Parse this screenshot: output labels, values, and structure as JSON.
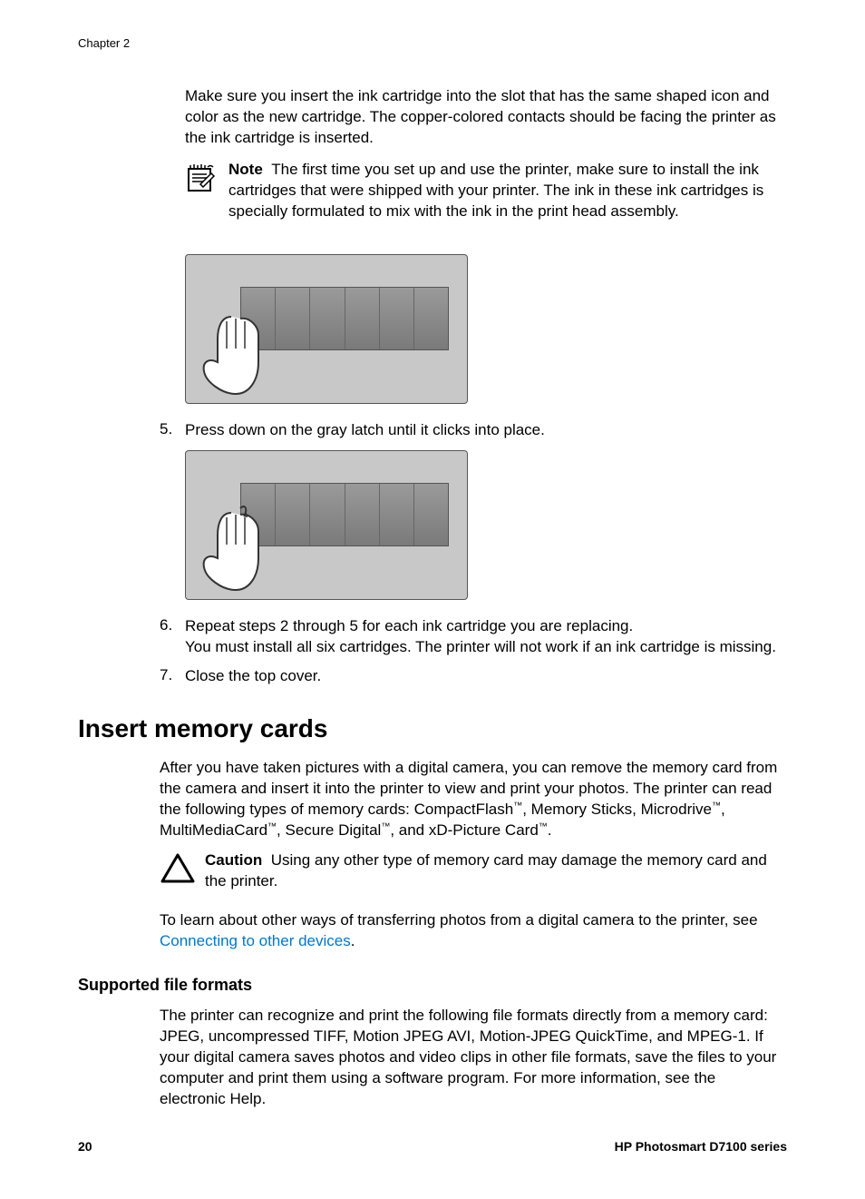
{
  "header": {
    "chapter": "Chapter 2"
  },
  "intro_para": "Make sure you insert the ink cartridge into the slot that has the same shaped icon and color as the new cartridge. The copper-colored contacts should be facing the printer as the ink cartridge is inserted.",
  "note": {
    "label": "Note",
    "text": "The first time you set up and use the printer, make sure to install the ink cartridges that were shipped with your printer. The ink in these ink cartridges is specially formulated to mix with the ink in the print head assembly."
  },
  "steps": {
    "s5": {
      "num": "5.",
      "text": "Press down on the gray latch until it clicks into place."
    },
    "s6": {
      "num": "6.",
      "text_a": "Repeat steps 2 through 5 for each ink cartridge you are replacing.",
      "text_b": "You must install all six cartridges. The printer will not work if an ink cartridge is missing."
    },
    "s7": {
      "num": "7.",
      "text": "Close the top cover."
    }
  },
  "section": {
    "heading": "Insert memory cards",
    "para_pre": "After you have taken pictures with a digital camera, you can remove the memory card from the camera and insert it into the printer to view and print your photos. The printer can read the following types of memory cards: CompactFlash",
    "tm": "™",
    "para_mid1": ", Memory Sticks, Microdrive",
    "para_mid2": ", MultiMediaCard",
    "para_mid3": ", Secure Digital",
    "para_mid4": ", and xD-Picture Card",
    "para_end": "."
  },
  "caution": {
    "label": "Caution",
    "text": "Using any other type of memory card may damage the memory card and the printer."
  },
  "learn": {
    "pre": "To learn about other ways of transferring photos from a digital camera to the printer, see ",
    "link": "Connecting to other devices",
    "post": "."
  },
  "sub": {
    "heading": "Supported file formats",
    "para": "The printer can recognize and print the following file formats directly from a memory card: JPEG, uncompressed TIFF, Motion JPEG AVI, Motion-JPEG QuickTime, and MPEG-1. If your digital camera saves photos and video clips in other file formats, save the files to your computer and print them using a software program. For more information, see the electronic Help."
  },
  "footer": {
    "page": "20",
    "series": "HP Photosmart D7100 series"
  }
}
